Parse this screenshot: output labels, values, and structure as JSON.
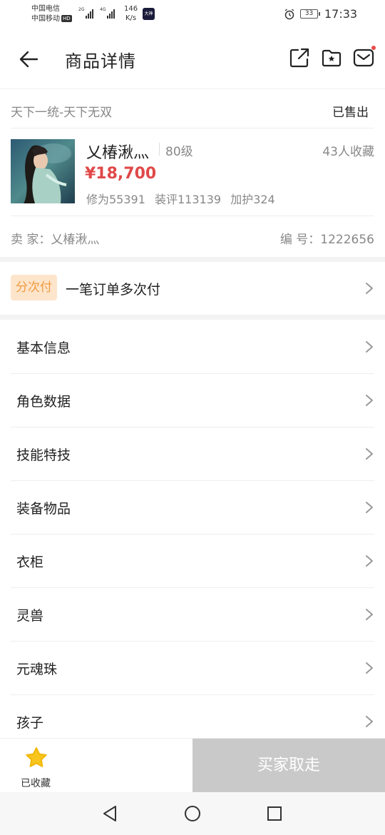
{
  "status_bar": {
    "carrier1": "中国电信",
    "carrier2": "中国移动",
    "hd": "HD",
    "sig1": "2G",
    "sig2": "4G",
    "speed": "146",
    "speed_unit": "K/s",
    "app_badge": "大神",
    "battery": "33",
    "time": "17:33"
  },
  "header": {
    "title": "商品详情"
  },
  "item": {
    "server": "天下一统-天下无双",
    "status": "已售出",
    "name": "乂椿湫灬",
    "level": "80级",
    "favorites": "43人收藏",
    "price": "¥18,700",
    "stats": [
      "修为55391",
      "装评113139",
      "加护324"
    ],
    "seller": "卖 家：乂椿湫灬",
    "number": "编 号：1222656"
  },
  "installment": {
    "badge": "分次付",
    "text": "一笔订单多次付"
  },
  "menu": [
    {
      "label": "基本信息"
    },
    {
      "label": "角色数据"
    },
    {
      "label": "技能特技"
    },
    {
      "label": "装备物品"
    },
    {
      "label": "衣柜"
    },
    {
      "label": "灵兽"
    },
    {
      "label": "元魂珠"
    },
    {
      "label": "孩子"
    }
  ],
  "bottom": {
    "collect_label": "已收藏",
    "buy_label": "买家取走"
  },
  "colors": {
    "price": "#e04848",
    "badge_bg": "#fde5cc",
    "badge_text": "#f09a3c",
    "star": "#f7c51e",
    "disabled_button": "#c9c9c9"
  }
}
